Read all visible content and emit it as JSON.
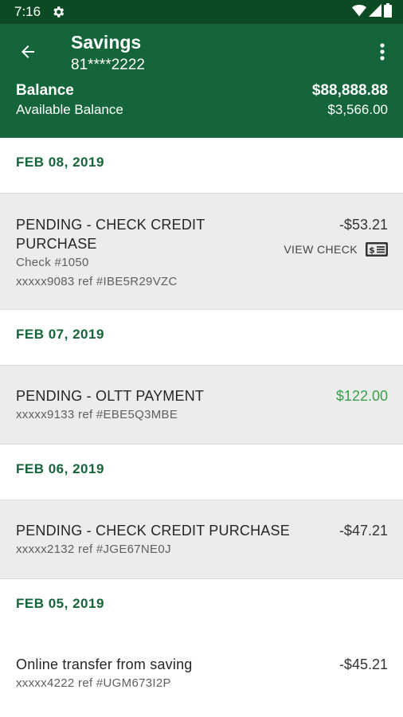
{
  "status_bar": {
    "time": "7:16",
    "icons": [
      "gear-icon",
      "wifi-icon",
      "signal-icon",
      "battery-icon"
    ]
  },
  "header": {
    "title": "Savings",
    "account_number": "81****2222",
    "balance_label": "Balance",
    "balance_value": "$88,888.88",
    "available_label": "Available Balance",
    "available_value": "$3,566.00"
  },
  "colors": {
    "status_bar_bg": "#0c4a23",
    "header_bg": "#15653a",
    "date_text": "#15653a",
    "positive_amount": "#3aa04a",
    "row_bg": "#ececec"
  },
  "transactions": [
    {
      "date": "FEB 08, 2019",
      "description_line1": "PENDING - CHECK CREDIT",
      "description_line2": "PURCHASE",
      "check": "Check #1050",
      "ref": "xxxxx9083 ref #IBE5R29VZC",
      "amount": "-$53.21",
      "view_check_label": "VIEW CHECK"
    },
    {
      "date": "FEB 07, 2019",
      "description": "PENDING - OLTT PAYMENT",
      "ref": "xxxxx9133 ref #EBE5Q3MBE",
      "amount": "$122.00"
    },
    {
      "date": "FEB 06, 2019",
      "description": "PENDING - CHECK CREDIT PURCHASE",
      "ref": "xxxxx2132 ref #JGE67NE0J",
      "amount": "-$47.21"
    },
    {
      "date": "FEB 05, 2019",
      "description": "Online transfer from saving",
      "ref": "xxxxx4222 ref #UGM673I2P",
      "amount": "-$45.21"
    }
  ]
}
